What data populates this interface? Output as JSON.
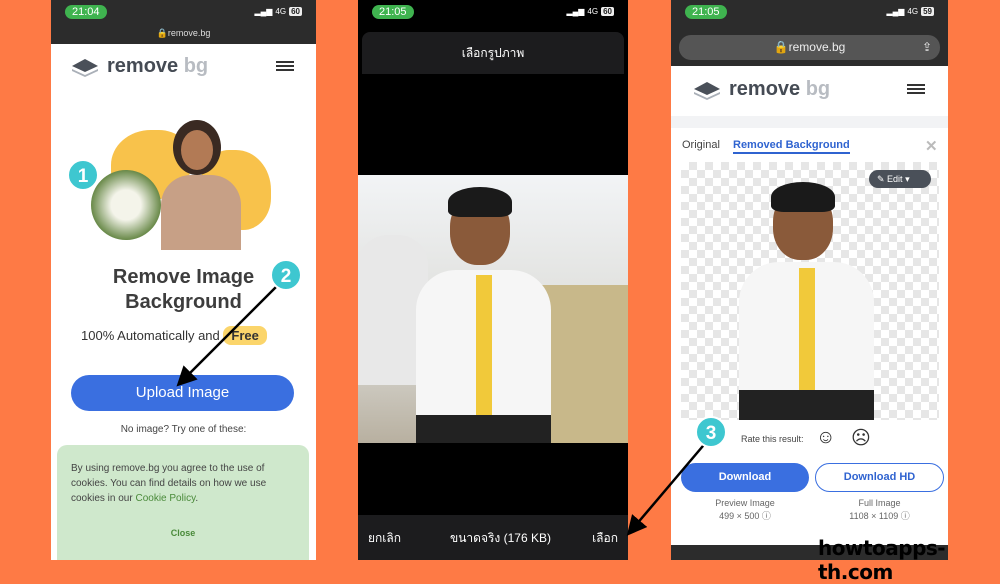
{
  "colors": {
    "background": "#fe7a45",
    "accent": "#3a6fe0",
    "badge": "#3ec7d0",
    "cookie_bg": "#cfe8cc",
    "cookie_text": "#4a8a3a"
  },
  "phone1": {
    "status": {
      "time": "21:04",
      "network": "4G",
      "battery": "60"
    },
    "url": "remove.bg",
    "logo": {
      "word1": "remove",
      "word2": "bg"
    },
    "title_line1": "Remove Image",
    "title_line2": "Background",
    "subtitle": "100% Automatically and",
    "free_badge": "Free",
    "upload_button": "Upload Image",
    "no_image": "No image? Try one of these:",
    "cookie": {
      "text": "By using remove.bg you agree to the use of cookies. You can find details on how we use cookies in our ",
      "link": "Cookie Policy",
      "period": ".",
      "close": "Close"
    }
  },
  "phone2": {
    "status": {
      "time": "21:05",
      "network": "4G",
      "battery": "60"
    },
    "title": "เลือกรูปภาพ",
    "cancel": "ยกเลิก",
    "size": "ขนาดจริง (176 KB)",
    "choose": "เลือก"
  },
  "phone3": {
    "status": {
      "time": "21:05",
      "network": "4G",
      "battery": "59"
    },
    "url": "remove.bg",
    "logo": {
      "word1": "remove",
      "word2": "bg"
    },
    "tabs": [
      {
        "label": "Original",
        "active": false
      },
      {
        "label": "Removed Background",
        "active": true
      }
    ],
    "edit_button": "Edit",
    "rate_label": "Rate this result:",
    "download": "Download",
    "download_hd": "Download HD",
    "preview_label": "Preview Image",
    "preview_size": "499 × 500",
    "full_label": "Full Image",
    "full_size": "1108 × 1109"
  },
  "steps": [
    "1",
    "2",
    "3"
  ],
  "watermark": "howtoapps-th.com"
}
